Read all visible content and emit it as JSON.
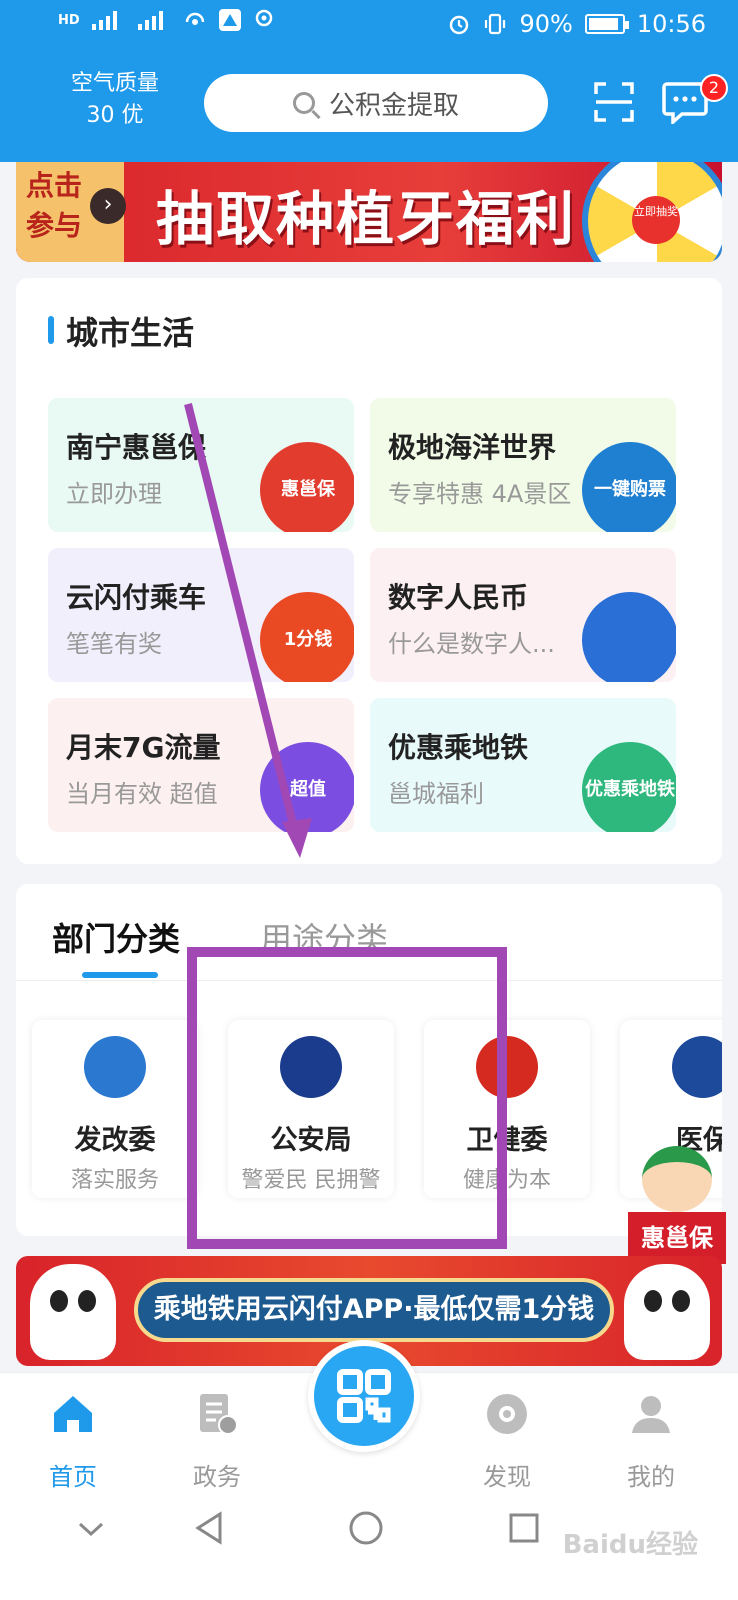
{
  "status_bar": {
    "network": [
      "HD",
      "4G",
      "4G"
    ],
    "battery": "90%",
    "battery_level": 0.9,
    "time": "10:56"
  },
  "header": {
    "air_label": "空气质量",
    "air_value": "30 优",
    "search_placeholder": "公积金提取",
    "message_badge": "2"
  },
  "banner_top": {
    "cta": "点击参与",
    "title": "抽取种植牙福利",
    "wheel_center": "立即抽奖"
  },
  "city_life": {
    "title": "城市生活",
    "cards": [
      {
        "title": "南宁惠邕保",
        "subtitle": "立即办理",
        "art": "惠邕保",
        "bg": "#e9f9f3",
        "art_color": "#e23c2e"
      },
      {
        "title": "极地海洋世界",
        "subtitle": "专享特惠 4A景区",
        "art": "一键购票",
        "bg": "#f1fbe7",
        "art_color": "#1f7fd1"
      },
      {
        "title": "云闪付乘车",
        "subtitle": "笔笔有奖",
        "art": "1分钱",
        "bg": "#f1effc",
        "art_color": "#e94a24"
      },
      {
        "title": "数字人民币",
        "subtitle": "什么是数字人...",
        "art": "",
        "bg": "#fdf0f2",
        "art_color": "#2a6fd6"
      },
      {
        "title": "月末7G流量",
        "subtitle": "当月有效  超值",
        "art": "超值",
        "bg": "#fdf0f0",
        "art_color": "#7b4de0"
      },
      {
        "title": "优惠乘地铁",
        "subtitle": "邕城福利",
        "art": "优惠乘地铁",
        "bg": "#e8fbfa",
        "art_color": "#2fb87e"
      }
    ]
  },
  "categories": {
    "tabs": [
      "部门分类",
      "用途分类"
    ],
    "departments": [
      {
        "name": "发改委",
        "desc": "落实服务",
        "icon_color": "#2b78d0"
      },
      {
        "name": "公安局",
        "desc": "警爱民 民拥警",
        "icon_color": "#1b3c8c"
      },
      {
        "name": "卫健委",
        "desc": "健康为本",
        "icon_color": "#d42a1f"
      },
      {
        "name": "医保",
        "desc": "",
        "icon_color": "#1d4a9a"
      }
    ]
  },
  "banner_bottom": {
    "text": "乘地铁用云闪付APP·最低仅需1分钱"
  },
  "floating": {
    "label": "惠邕保"
  },
  "bottom_nav": {
    "items": [
      "首页",
      "政务",
      "发现",
      "我的"
    ]
  },
  "watermark": "Baidu经验"
}
